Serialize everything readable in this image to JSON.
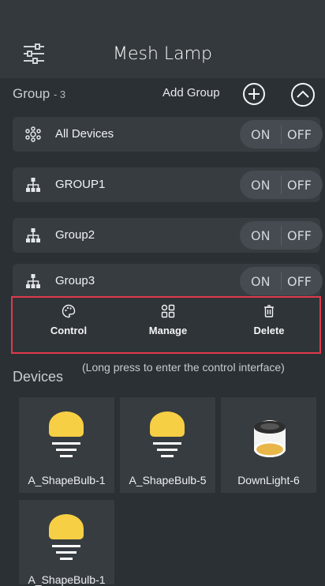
{
  "app": {
    "title": "Mesh Lamp"
  },
  "groups": {
    "title": "Group",
    "count": "- 3",
    "add_label": "Add Group",
    "items": [
      {
        "label": "All Devices",
        "icon": "all-devices-icon",
        "on": "ON",
        "off": "OFF"
      },
      {
        "label": "GROUP1",
        "icon": "group-icon",
        "on": "ON",
        "off": "OFF"
      },
      {
        "label": "Group2",
        "icon": "group-icon",
        "on": "ON",
        "off": "OFF"
      },
      {
        "label": "Group3",
        "icon": "group-icon",
        "on": "ON",
        "off": "OFF"
      }
    ]
  },
  "actions": [
    {
      "label": "Control",
      "icon": "palette-icon"
    },
    {
      "label": "Manage",
      "icon": "grid-icon"
    },
    {
      "label": "Delete",
      "icon": "trash-icon"
    }
  ],
  "devices": {
    "title": "Devices",
    "hint": "(Long press to enter the control interface)",
    "items": [
      {
        "label": "A_ShapeBulb-1",
        "icon": "bulb-icon"
      },
      {
        "label": "A_ShapeBulb-5",
        "icon": "bulb-icon"
      },
      {
        "label": "DownLight-6",
        "icon": "downlight-icon"
      },
      {
        "label": "A_ShapeBulb-1",
        "icon": "bulb-icon"
      }
    ]
  },
  "colors": {
    "accent_red": "#e0394b",
    "bulb_yellow": "#f7cf45",
    "background": "#2b3034"
  }
}
